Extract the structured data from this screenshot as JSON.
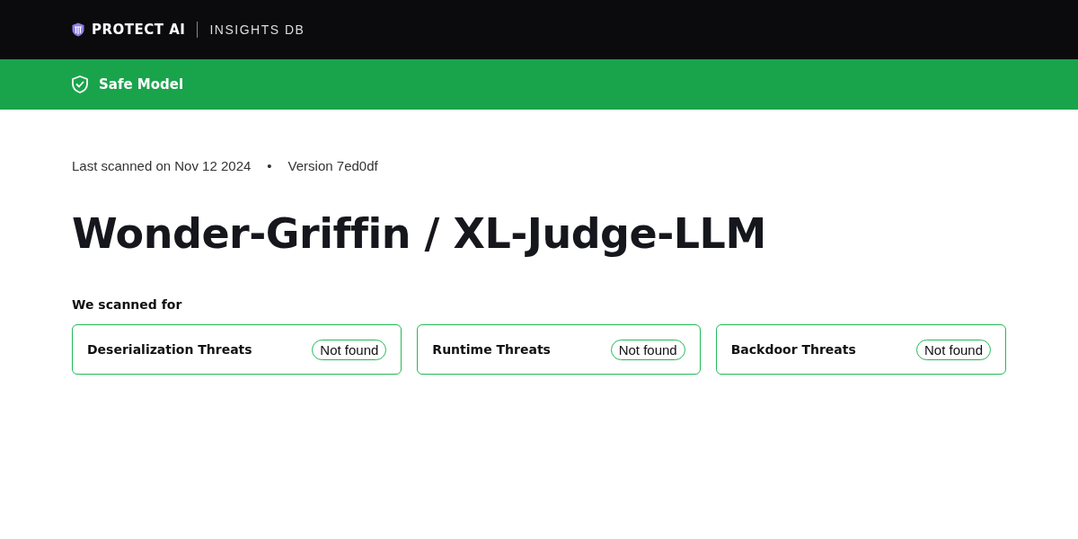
{
  "header": {
    "brand": "PROTECT AI",
    "product": "INSIGHTS DB"
  },
  "status_banner": {
    "safe": true,
    "label": "Safe Model"
  },
  "scan_info": {
    "last_scanned": "Last scanned on Nov 12 2024",
    "separator": "•",
    "version": "Version 7ed0df"
  },
  "title": "Wonder-Griffin / XL-Judge-LLM",
  "scanned_for": {
    "heading": "We scanned for",
    "threats": [
      {
        "name": "Deserialization Threats",
        "result": "Not found",
        "found": false
      },
      {
        "name": "Runtime Threats",
        "result": "Not found",
        "found": false
      },
      {
        "name": "Backdoor Threats",
        "result": "Not found",
        "found": false
      }
    ]
  }
}
